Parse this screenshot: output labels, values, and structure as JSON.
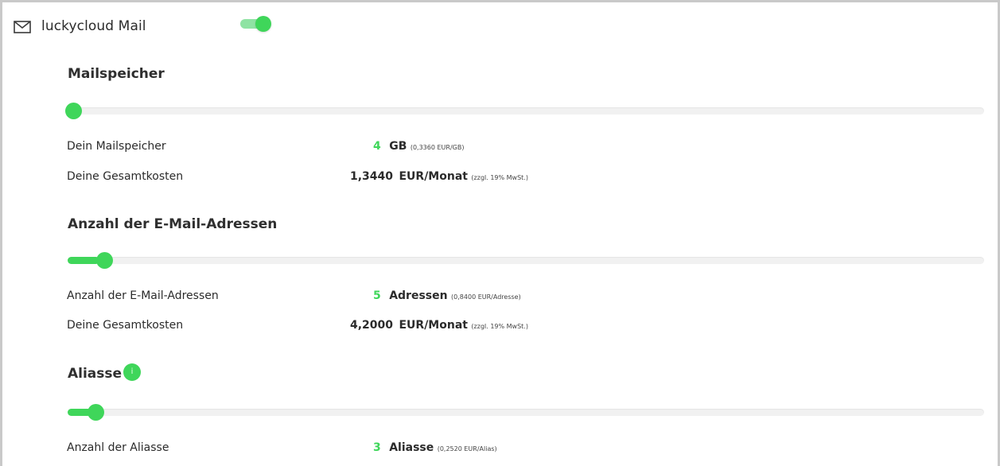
{
  "header": {
    "title": "luckycloud Mail",
    "icon": "mail-icon",
    "toggle_on": true
  },
  "colors": {
    "accent": "#3fd65a",
    "border": "#c9c9c9",
    "track": "#f1f1f1"
  },
  "sections": [
    {
      "title": "Mailspeicher",
      "slider_value": 4,
      "rows": [
        {
          "label": "Dein Mailspeicher",
          "number": "4",
          "unit": "GB",
          "detail": "(0,3360 EUR/GB)"
        },
        {
          "label": "Deine Gesamtkosten",
          "number": "1,3440",
          "unit": "EUR/Monat",
          "detail": "(zzgl. 19% MwSt.)"
        }
      ]
    },
    {
      "title": "Anzahl der E-Mail-Adressen",
      "slider_value": 5,
      "rows": [
        {
          "label": "Anzahl der E-Mail-Adressen",
          "number": "5",
          "unit": "Adressen",
          "detail": "(0,8400 EUR/Adresse)"
        },
        {
          "label": "Deine Gesamtkosten",
          "number": "4,2000",
          "unit": "EUR/Monat",
          "detail": "(zzgl. 19% MwSt.)"
        }
      ]
    },
    {
      "title": "Aliasse",
      "badge": "i",
      "slider_value": 3,
      "rows": [
        {
          "label": "Anzahl der Aliasse",
          "number": "3",
          "unit": "Aliasse",
          "detail": "(0,2520 EUR/Alias)"
        }
      ]
    }
  ]
}
